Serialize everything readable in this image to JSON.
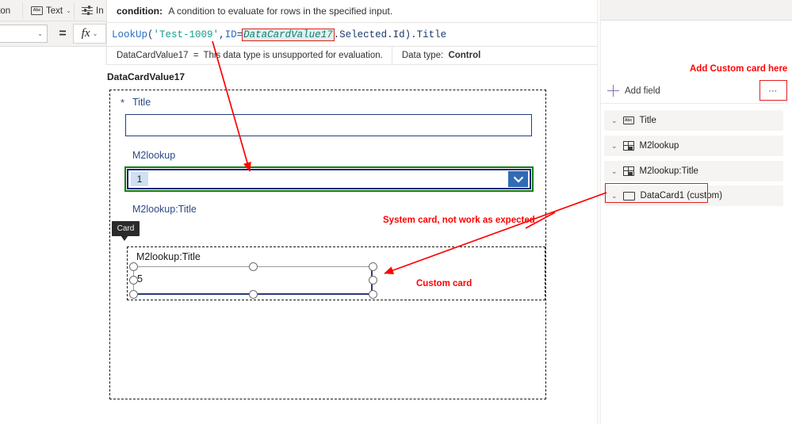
{
  "ribbon": {
    "left_partial_label": "tton",
    "text_button": {
      "label": "Text",
      "chevron": "⌄",
      "icon": "abc-icon",
      "abc": "Abc"
    },
    "insert_button": {
      "label": "In",
      "icon": "sliders-icon"
    }
  },
  "property_bar": {
    "property_dropdown_value": "",
    "property_dropdown_chevron": "⌄",
    "equals_sign": "=",
    "fx_label": "fx",
    "fx_chevron": "⌄"
  },
  "intellisense": {
    "param_name": "condition:",
    "param_description": "A condition to evaluate for rows in the specified input."
  },
  "formula": {
    "fn_name": "LookUp",
    "open_paren": "(",
    "table_name": "'Test-1009'",
    "comma1": ",",
    "field_name": "ID",
    "operator": "=",
    "control_ref": "DataCardValue17",
    "suffix": ".Selected.Id",
    "close_paren": ")",
    "property": ".Title",
    "full_text": "LookUp('Test-1009',ID=DataCardValue17.Selected.Id).Title"
  },
  "evaluation": {
    "control_name": "DataCardValue17",
    "equals": "=",
    "message": "This data type is unsupported for evaluation.",
    "data_type_label": "Data type:",
    "data_type_value": "Control"
  },
  "canvas": {
    "selected_control_title": "DataCardValue17",
    "form": {
      "required_star": "*",
      "title_field_label": "Title",
      "title_field_value": "",
      "m2lookup_label": "M2lookup",
      "m2lookup_value": "1",
      "m2lookup_chevron": "chevron-down-icon",
      "m2lookup_title_label": "M2lookup:Title"
    },
    "card_tooltip": "Card",
    "custom_card": {
      "label": "M2lookup:Title",
      "input_value": "5"
    }
  },
  "right_panel": {
    "add_field_label": "Add field",
    "more_options_label": "⋯",
    "fields": [
      {
        "label": "Title",
        "icon": "abc-text-icon",
        "chevron": "⌄",
        "highlighted": false
      },
      {
        "label": "M2lookup",
        "icon": "lookup-grid-icon",
        "chevron": "⌄",
        "highlighted": false
      },
      {
        "label": "M2lookup:Title",
        "icon": "lookup-grid-icon",
        "chevron": "⌄",
        "highlighted": false
      },
      {
        "label": "DataCard1 (custom)",
        "icon": "rectangle-card-icon",
        "chevron": "⌄",
        "highlighted": true
      }
    ]
  },
  "annotations": {
    "add_custom_card_here": "Add Custom card here",
    "system_card": "System card, not work as expected",
    "custom_card": "Custom card"
  },
  "colors": {
    "annotation_red": "#ff0000",
    "highlight_red": "#e02020",
    "selection_green": "#107c10",
    "control_navy": "#17237a",
    "field_label_blue": "#2b4a87",
    "accent_purple": "#8b6fb0"
  }
}
